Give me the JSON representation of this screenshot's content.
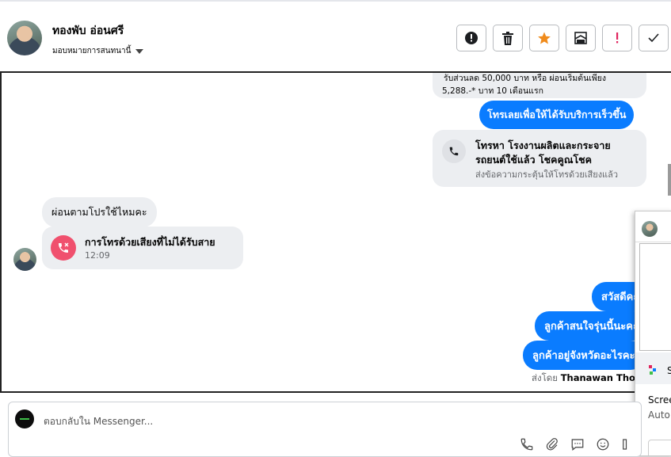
{
  "header": {
    "contact_name": "ทองพับ อ่อนศรี",
    "assign_label": "มอบหมายการสนทนานี้"
  },
  "actions": [
    {
      "name": "mark-spam-button",
      "icon": "alert-circle-icon"
    },
    {
      "name": "delete-button",
      "icon": "trash-icon"
    },
    {
      "name": "star-button",
      "icon": "star-icon",
      "color": "#f08b1c"
    },
    {
      "name": "archive-button",
      "icon": "mail-archive-icon"
    },
    {
      "name": "mark-follow-up-button",
      "icon": "exclamation-icon",
      "color": "#e0245e"
    },
    {
      "name": "mark-done-button",
      "icon": "check-icon"
    }
  ],
  "messages": {
    "promo_line1": "รับส่วนลด 50,000 บาท หรือ  ผ่อนเริ่มต้นเพียง",
    "promo_line2": "5,288.-* บาท 10 เดือนแรก",
    "call_cta": "โทรเลยเพื่อให้ได้รับบริการเร็วขึ้น",
    "call_card_title_line1": "โทรหา โรงงานผลิตและกระจาย",
    "call_card_title_line2": "รถยนต์ใช้แล้ว โชคคูณโชค",
    "call_card_sub": "ส่งข้อความกระตุ้นให้โทรด้วยเสียงแล้ว",
    "customer_question": "ผ่อนตามโปรใช้ไหมคะ",
    "missed_call_title": "การโทรด้วยเสียงที่ไม่ได้รับสาย",
    "missed_call_time": "12:09",
    "reply1": "สวัสดีคะ",
    "reply2": "ลูกค้าสนใจรุ่นนี้นะคะ",
    "reply3": "ลูกค้าอยู่จังหวัดอะไรคะ",
    "sent_by_prefix": "ส่งโดย",
    "sent_by_name": "Thanawan Thon"
  },
  "overlay": {
    "line1": "S",
    "line2": "Scree",
    "line3": "Auto"
  },
  "composer": {
    "placeholder": "ตอบกลับใน Messenger..."
  },
  "colors": {
    "accent": "#0a7cff",
    "missed_call": "#f0506e"
  }
}
